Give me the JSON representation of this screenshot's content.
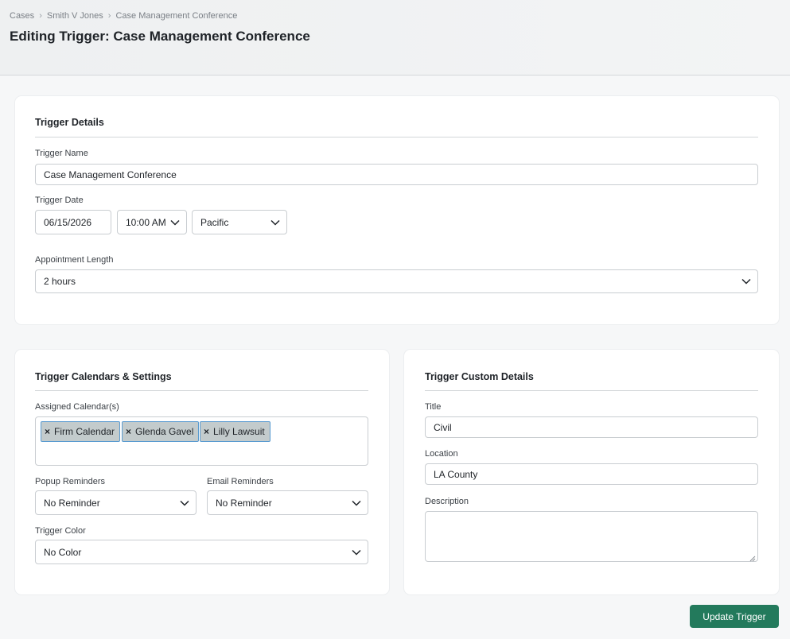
{
  "breadcrumb": {
    "items": [
      "Cases",
      "Smith V Jones",
      "Case Management Conference"
    ],
    "separator": "›"
  },
  "page_title": "Editing Trigger: Case Management Conference",
  "trigger_details": {
    "title": "Trigger Details",
    "name_label": "Trigger Name",
    "name_value": "Case Management Conference",
    "date_label": "Trigger Date",
    "date_value": "06/15/2026",
    "time_value": "10:00 AM",
    "timezone_value": "Pacific",
    "length_label": "Appointment Length",
    "length_value": "2 hours"
  },
  "calendars_settings": {
    "title": "Trigger Calendars & Settings",
    "assigned_label": "Assigned Calendar(s)",
    "tags": [
      "Firm Calendar",
      "Glenda Gavel",
      "Lilly Lawsuit"
    ],
    "tag_remove_glyph": "×",
    "popup_label": "Popup Reminders",
    "popup_value": "No Reminder",
    "email_label": "Email Reminders",
    "email_value": "No Reminder",
    "color_label": "Trigger Color",
    "color_value": "No Color"
  },
  "custom_details": {
    "title": "Trigger Custom Details",
    "title_label": "Title",
    "title_value": "Civil",
    "location_label": "Location",
    "location_value": "LA County",
    "description_label": "Description",
    "description_value": ""
  },
  "actions": {
    "update_label": "Update Trigger"
  },
  "colors": {
    "primary_button": "#237a5c",
    "tag_bg": "#c3cbcc",
    "tag_border": "#5a9bd0",
    "page_bg": "#f6f7f8"
  },
  "icons": {
    "select_arrow": "chevron-down-icon",
    "tag_remove": "close-icon"
  }
}
